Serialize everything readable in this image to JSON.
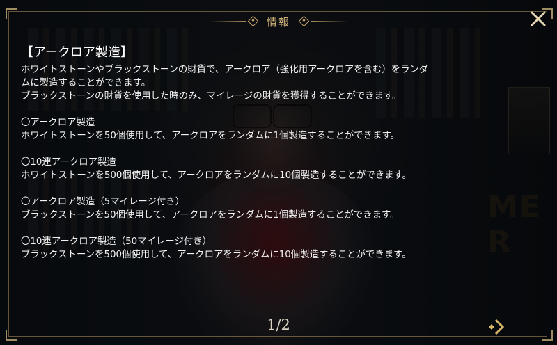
{
  "dialog": {
    "title": "情報",
    "heading": "【アークロア製造】",
    "intro": [
      "ホワイトストーンやブラックストーンの財貨で、アークロア（強化用アークロアを含む）をランダ",
      "ムに製造することができます。",
      "ブラックストーンの財貨を使用した時のみ、マイレージの財貨を獲得することができます。"
    ],
    "sections": [
      {
        "title": "〇アークロア製造",
        "desc": "ホワイトストーンを50個使用して、アークロアをランダムに1個製造することができます。"
      },
      {
        "title": "〇10連アークロア製造",
        "desc": "ホワイトストーンを500個使用して、アークロアをランダムに10個製造することができます。"
      },
      {
        "title": "〇アークロア製造（5マイレージ付き）",
        "desc": "ブラックストーンを50個使用して、アークロアをランダムに1個製造することができます。"
      },
      {
        "title": "〇10連アークロア製造（50マイレージ付き）",
        "desc": "ブラックストーンを500個使用して、アークロアをランダムに10個製造することができます。"
      }
    ],
    "page_indicator": "1/2",
    "close_icon": "close-x-icon",
    "next_icon": "next-page-arrow-icon"
  },
  "colors": {
    "accent_gold": "#cfb27a",
    "text": "#f2f2f2",
    "frame": "#b0966a"
  }
}
